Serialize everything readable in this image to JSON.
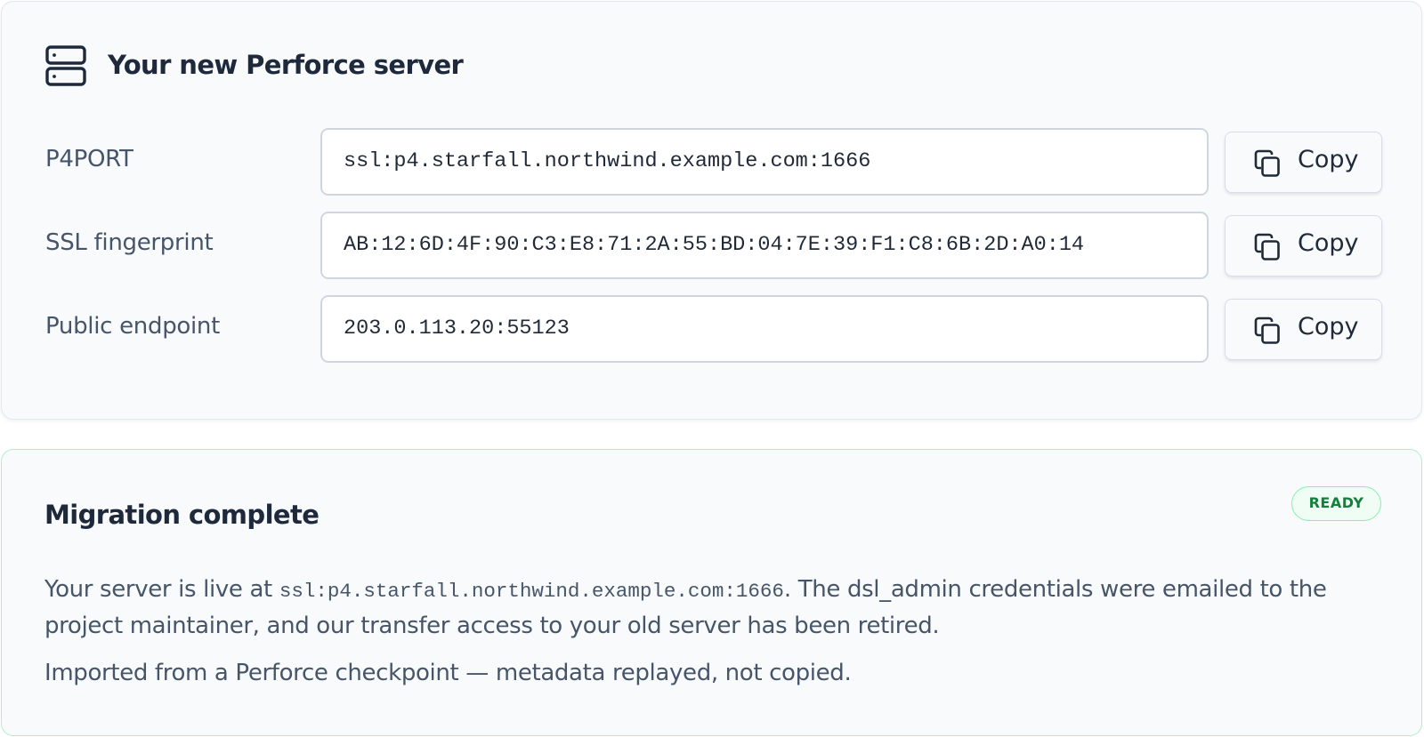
{
  "server_card": {
    "title": "Your new Perforce server",
    "icon": "server-icon",
    "rows": [
      {
        "label": "P4PORT",
        "value": "ssl:p4.starfall.northwind.example.com:1666",
        "copy_label": "Copy"
      },
      {
        "label": "SSL fingerprint",
        "value": "AB:12:6D:4F:90:C3:E8:71:2A:55:BD:04:7E:39:F1:C8:6B:2D:A0:14",
        "copy_label": "Copy"
      },
      {
        "label": "Public endpoint",
        "value": "203.0.113.20:55123",
        "copy_label": "Copy"
      }
    ]
  },
  "migration_card": {
    "title": "Migration complete",
    "status_badge": "READY",
    "paragraph_1": {
      "before_code": "Your server is live at ",
      "code": "ssl:p4.starfall.northwind.example.com:1666",
      "after_code": ". The dsl_admin credentials were emailed to the project maintainer, and our transfer access to your old server has been retired."
    },
    "paragraph_2": "Imported from a Perforce checkpoint — metadata replayed, not copied."
  },
  "colors": {
    "success_green": "#15803d",
    "card_background": "#f8fafc",
    "muted_text": "#475569"
  }
}
